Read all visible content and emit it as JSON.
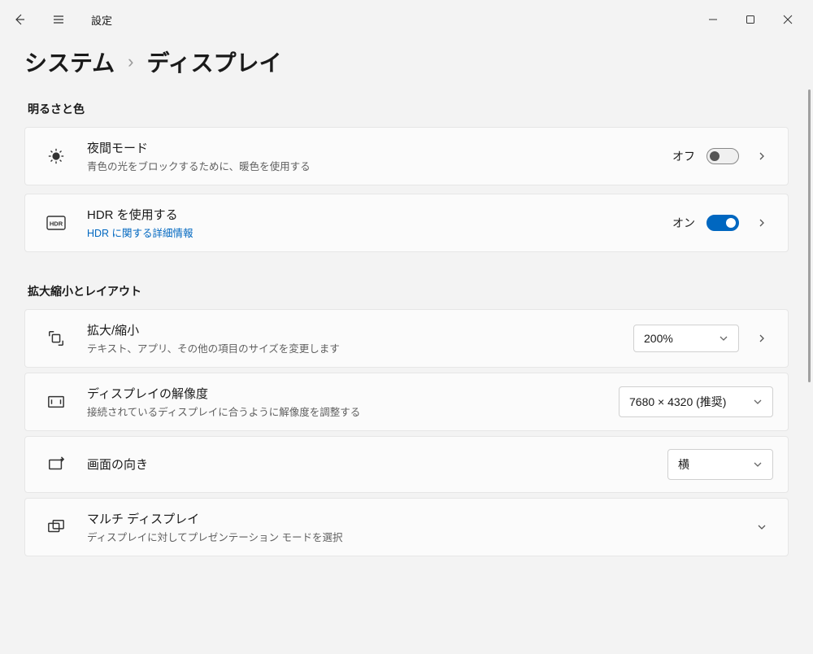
{
  "app": {
    "title": "設定"
  },
  "breadcrumb": {
    "parent": "システム",
    "sep": "›",
    "current": "ディスプレイ"
  },
  "section1": {
    "header": "明るさと色"
  },
  "night": {
    "title": "夜間モード",
    "sub": "青色の光をブロックするために、暖色を使用する",
    "state_label": "オフ",
    "on": false
  },
  "hdr": {
    "title": "HDR を使用する",
    "link": "HDR に関する詳細情報",
    "state_label": "オン",
    "on": true
  },
  "section2": {
    "header": "拡大縮小とレイアウト"
  },
  "scale": {
    "title": "拡大/縮小",
    "sub": "テキスト、アプリ、その他の項目のサイズを変更します",
    "value": "200%"
  },
  "resolution": {
    "title": "ディスプレイの解像度",
    "sub": "接続されているディスプレイに合うように解像度を調整する",
    "value": "7680 × 4320 (推奨)"
  },
  "orientation": {
    "title": "画面の向き",
    "value": "横"
  },
  "multi": {
    "title": "マルチ ディスプレイ",
    "sub": "ディスプレイに対してプレゼンテーション モードを選択"
  }
}
